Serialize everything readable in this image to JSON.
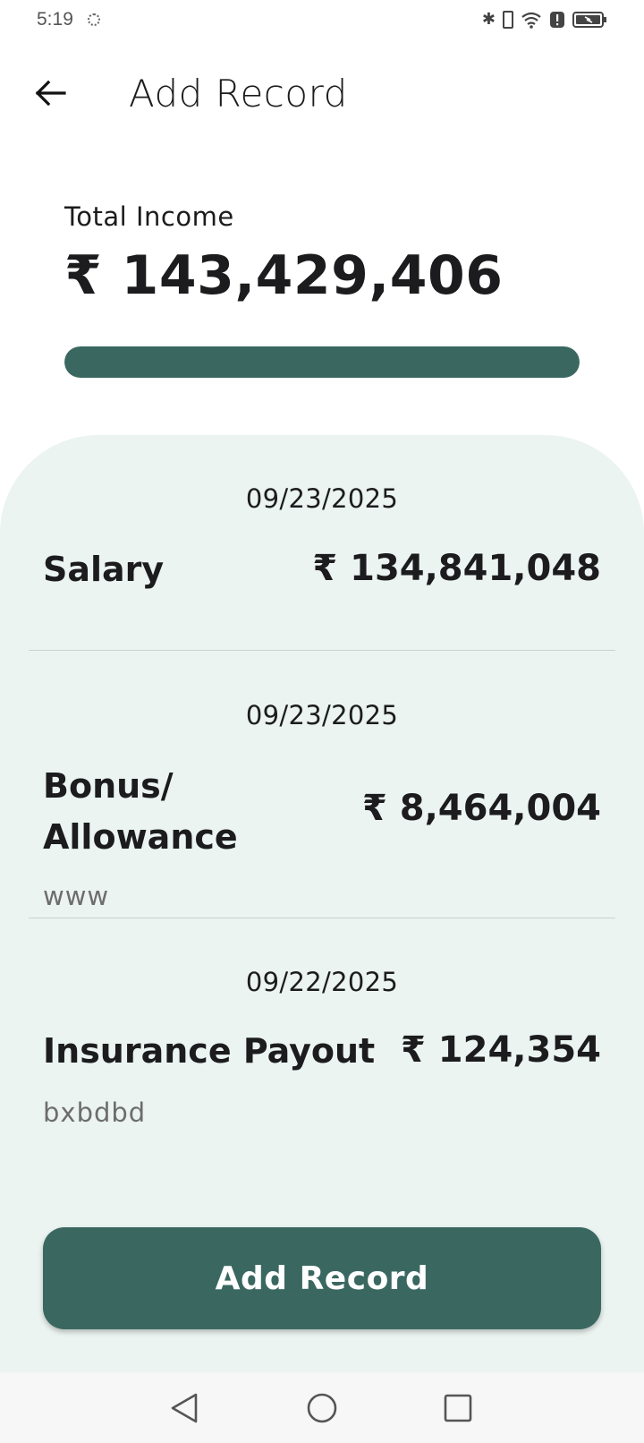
{
  "status_bar": {
    "time": "5:19"
  },
  "header": {
    "title": "Add Record"
  },
  "summary": {
    "label": "Total Income",
    "amount": "₹ 143,429,406",
    "progress": 1.0
  },
  "records": [
    {
      "date": "09/23/2025",
      "title": "Salary",
      "amount": "₹ 134,841,048",
      "note": ""
    },
    {
      "date": "09/23/2025",
      "title_line1": "Bonus/",
      "title_line2": "Allowance",
      "amount": "₹ 8,464,004",
      "note": "www"
    },
    {
      "date": "09/22/2025",
      "title": "Insurance Payout",
      "amount": "₹ 124,354",
      "note": "bxbdbd"
    }
  ],
  "actions": {
    "add_record_label": "Add Record"
  },
  "colors": {
    "accent": "#3a6861",
    "panel_bg": "#ebf4f1"
  }
}
